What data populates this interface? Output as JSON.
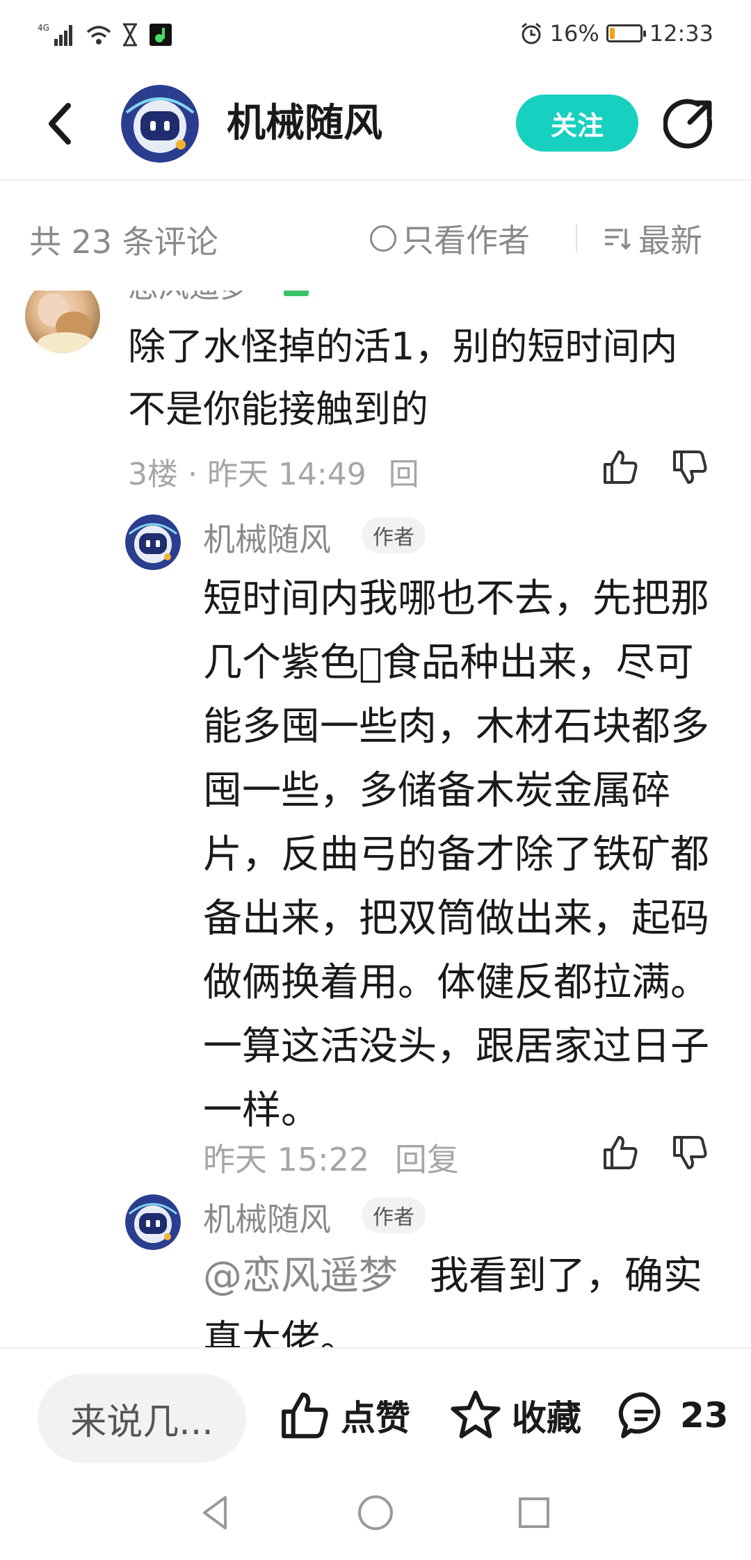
{
  "status_bar": {
    "network": "4G",
    "battery_percent": "16%",
    "battery_level": 0.16,
    "time": "12:33"
  },
  "header": {
    "title": "机械随风",
    "follow_label": "关注"
  },
  "filter": {
    "count_label": "共 23 条评论",
    "author_only_label": "只看作者",
    "sort_label": "最新"
  },
  "comment": {
    "author": "恋风遥梦",
    "text": "除了水怪掉的活1，别的短时间内不是你能接触到的",
    "meta": "3楼 · 昨天 14:49",
    "reply_label": "回"
  },
  "replies": [
    {
      "author": "机械随风",
      "tag": "作者",
      "text": "短时间内我哪也不去，先把那几个紫色\u0000食品种出来，尽可能多囤一些肉，木材石块都多囤一些，多储备木炭金属碎片，反曲弓的备才除了铁矿都备出来，把双筒做出来，起码做俩换着用。体健反都拉满。一算这活没头，跟居家过日子一样。",
      "time": "昨天 15:22",
      "reply_label": "回复"
    },
    {
      "author": "机械随风",
      "tag": "作者",
      "mention": "@恋风遥梦",
      "text": "我看到了，确实真大佬。"
    }
  ],
  "bottom_bar": {
    "input_placeholder": "来说几...",
    "like_label": "点赞",
    "favorite_label": "收藏",
    "comment_count": "23"
  },
  "colors": {
    "accent": "#17d0c0",
    "muted_text": "#8a8a8a",
    "primary_text": "#1a1a1a"
  }
}
